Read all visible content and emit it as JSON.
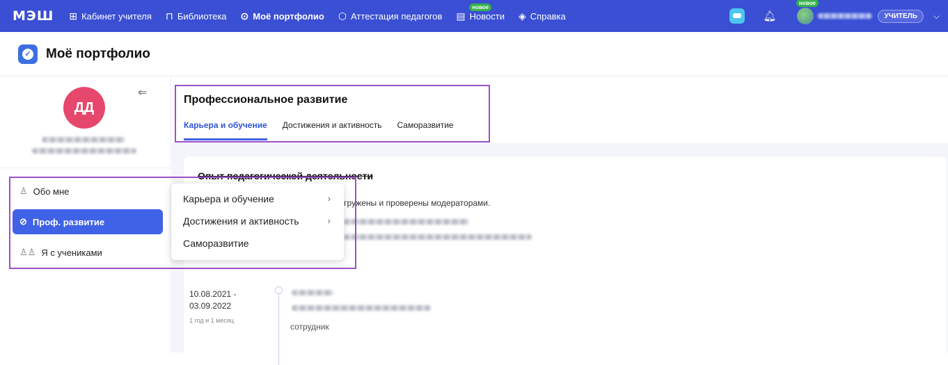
{
  "topnav": {
    "logo": "МЭШ",
    "items": [
      {
        "icon": "grid-icon",
        "glyph": "⊞",
        "label": "Кабинет учителя"
      },
      {
        "icon": "bookmark-icon",
        "glyph": "⊓",
        "label": "Библиотека"
      },
      {
        "icon": "check-circle-icon",
        "glyph": "✓",
        "label": "Моё портфолио"
      },
      {
        "icon": "cube-icon",
        "glyph": "⬡",
        "label": "Аттестация педагогов"
      },
      {
        "icon": "news-icon",
        "glyph": "▤",
        "label": "Новости",
        "badge": "новое"
      },
      {
        "icon": "diamond-icon",
        "glyph": "◇",
        "label": "Справка"
      }
    ],
    "avatar_badge": "новое",
    "role": "УЧИТЕЛЬ"
  },
  "page": {
    "title": "Моё портфолио"
  },
  "sidebar": {
    "avatar_initials": "ДД",
    "items": [
      {
        "label": "Обо мне",
        "icon": "person-icon"
      },
      {
        "label": "Проф. развитие",
        "icon": "growth-icon"
      },
      {
        "label": "Я с учениками",
        "icon": "people-icon"
      }
    ]
  },
  "main": {
    "section_title": "Профессиональное развитие",
    "tabs": [
      "Карьера и обучение",
      "Достижения и активность",
      "Саморазвитие"
    ],
    "card": {
      "title": "Опыт педагогической деятельности",
      "note": "загружены и проверены модераторами.",
      "date_line1": "10.08.2021 -",
      "date_line2": "03.09.2022",
      "duration": "1 год и 1 месяц",
      "role": "сотрудник"
    }
  },
  "popup": {
    "items": [
      {
        "label": "Карьера и обучение",
        "arrow": "›"
      },
      {
        "label": "Достижения и активность",
        "arrow": "›"
      },
      {
        "label": "Саморазвитие",
        "arrow": ""
      }
    ]
  },
  "colors": {
    "nav_bg": "#3a4fd3",
    "accent": "#3f62e6",
    "avatar": "#e6476d",
    "highlight": "#9b4fc7",
    "new_badge": "#36b24a"
  }
}
